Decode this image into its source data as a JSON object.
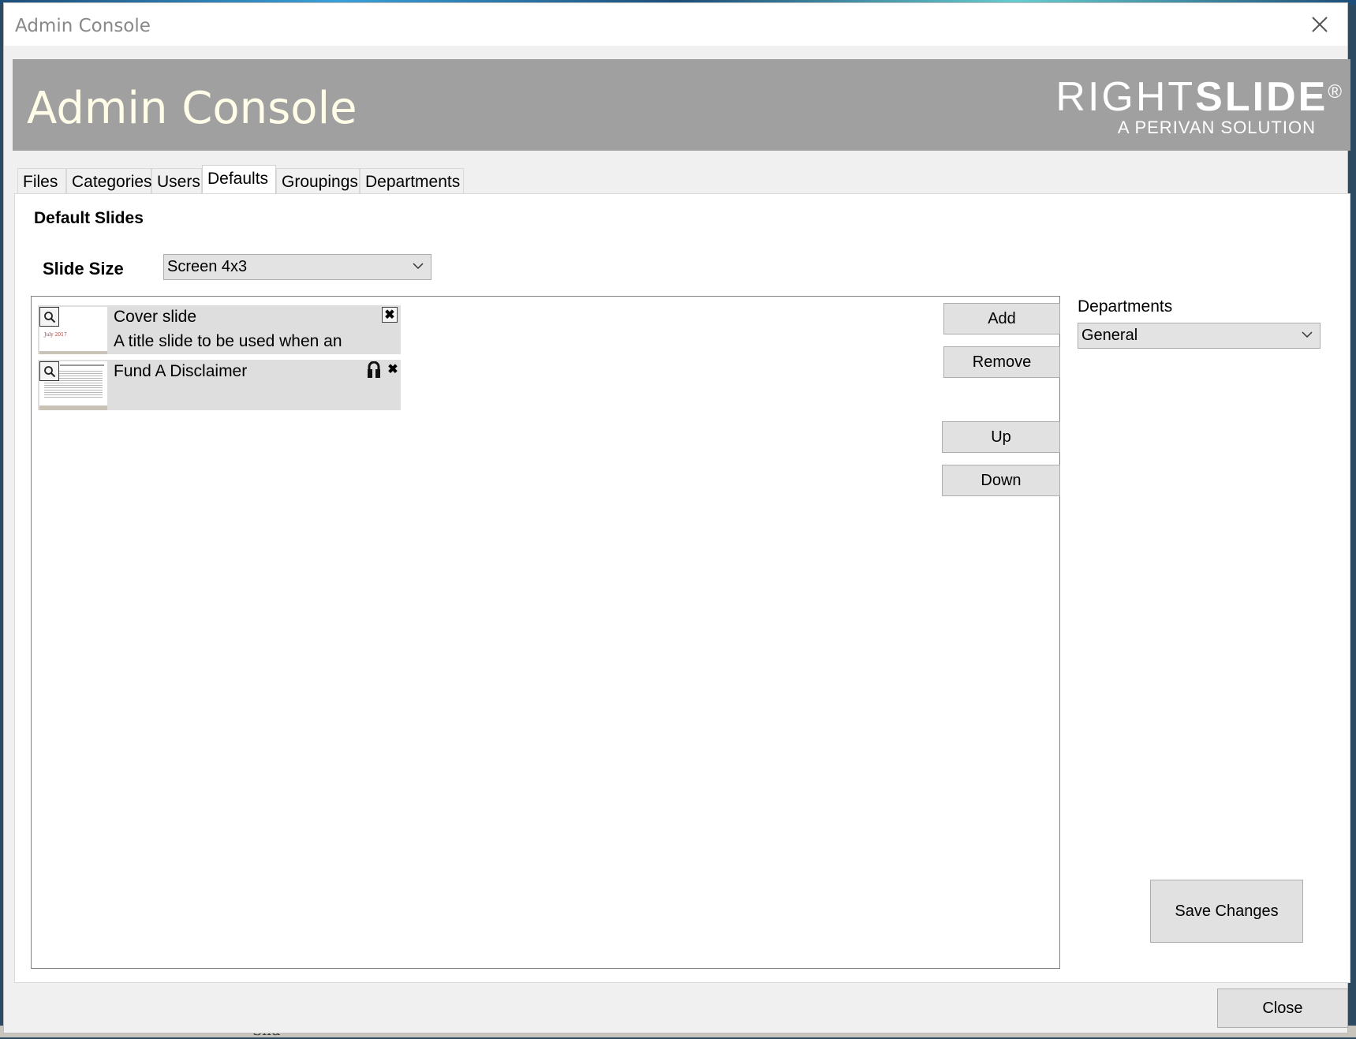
{
  "window": {
    "title": "Admin Console",
    "close_glyph": "✕"
  },
  "banner": {
    "title": "Admin Console",
    "brand_light": "RIGHT",
    "brand_bold": "SLIDE",
    "brand_reg": "®",
    "brand_sub": "A PERIVAN SOLUTION"
  },
  "tabs": [
    {
      "label": "Files"
    },
    {
      "label": "Categories"
    },
    {
      "label": "Users"
    },
    {
      "label": "Defaults",
      "active": true
    },
    {
      "label": "Groupings"
    },
    {
      "label": "Departments"
    }
  ],
  "defaults": {
    "heading": "Default Slides",
    "slide_size_label": "Slide Size",
    "slide_size_value": "Screen 4x3",
    "slides": [
      {
        "title": "Cover slide",
        "description": "A title slide to be used when an",
        "locked": false,
        "remove_glyph": "✖"
      },
      {
        "title": "Fund A Disclaimer",
        "description": "",
        "locked": true,
        "remove_glyph": "✖"
      }
    ],
    "buttons": {
      "add": "Add",
      "remove": "Remove",
      "up": "Up",
      "down": "Down"
    },
    "departments_label": "Departments",
    "departments_value": "General",
    "save": "Save Changes"
  },
  "footer": {
    "close": "Close"
  },
  "background": {
    "partial_text": "Slid"
  },
  "colors": {
    "banner": "#a0a0a0",
    "banner_title": "#fffce8",
    "slide_item": "#dedede",
    "button": "#e1e1e1"
  }
}
